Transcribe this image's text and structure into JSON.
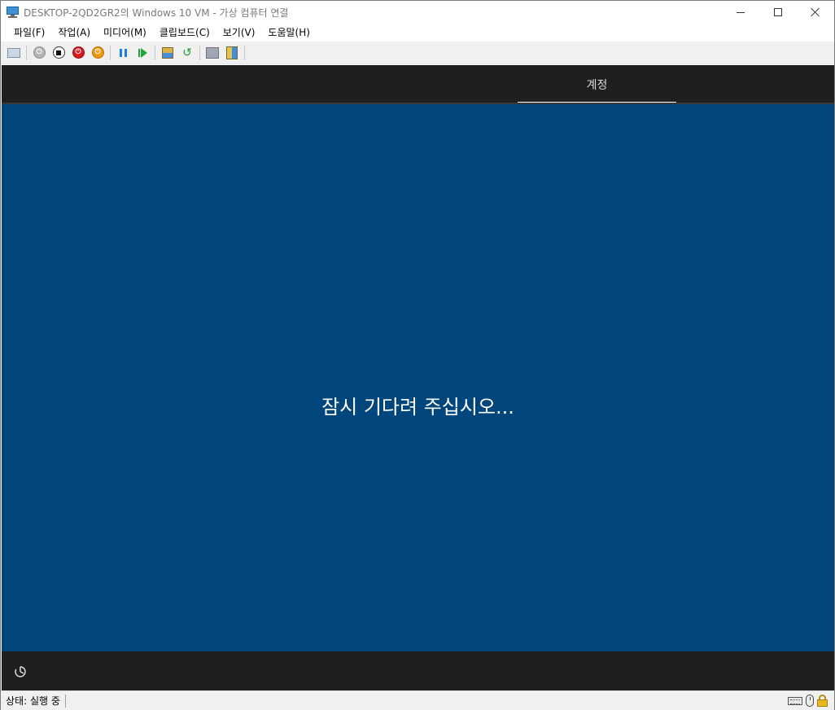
{
  "window": {
    "title": "DESKTOP-2QD2GR2의 Windows 10 VM - 가상 컴퓨터 연결"
  },
  "menu": {
    "items": [
      "파일(F)",
      "작업(A)",
      "미디어(M)",
      "클립보드(C)",
      "보기(V)",
      "도움말(H)"
    ]
  },
  "toolbar": {
    "buttons": [
      {
        "icon": "ctrl-alt-del-icon"
      },
      {
        "icon": "start-icon"
      },
      {
        "icon": "turn-off-icon"
      },
      {
        "icon": "shut-down-icon"
      },
      {
        "icon": "save-icon"
      },
      {
        "icon": "pause-icon"
      },
      {
        "icon": "resume-icon"
      },
      {
        "icon": "checkpoint-icon"
      },
      {
        "icon": "revert-icon"
      },
      {
        "icon": "enhanced-session-icon"
      },
      {
        "icon": "share-icon"
      }
    ]
  },
  "vm": {
    "tab_label": "계정",
    "message": "잠시 기다려 주십시오...",
    "background_color": "#00457c",
    "bar_color": "#1f1f1f"
  },
  "status": {
    "text": "상태: 실행 중"
  }
}
